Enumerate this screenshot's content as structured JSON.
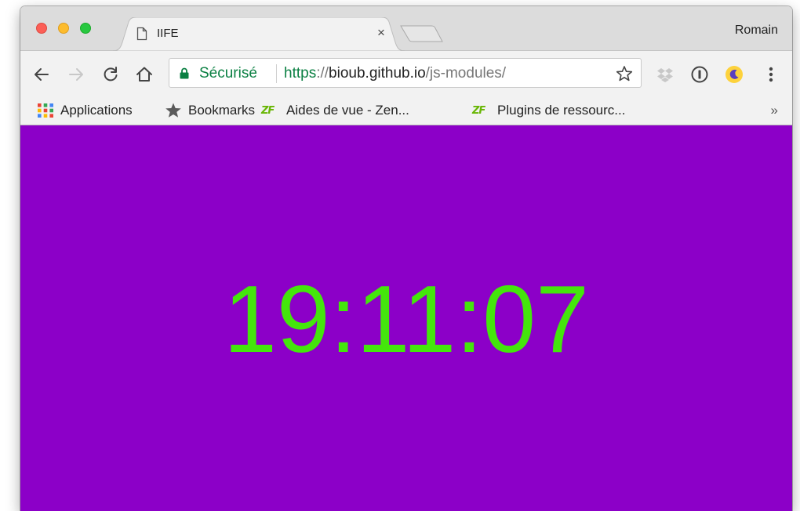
{
  "window": {
    "profile_name": "Romain"
  },
  "tabs": [
    {
      "title": "IIFE",
      "active": true,
      "close_label": "×"
    }
  ],
  "toolbar": {
    "secure_label": "Sécurisé",
    "url": {
      "scheme": "https",
      "separator": "://",
      "host": "bioub.github.io",
      "path": "/js-modules/"
    }
  },
  "bookmarks": {
    "items": [
      {
        "label": "Applications",
        "icon": "apps-grid-icon"
      },
      {
        "label": "Bookmarks",
        "icon": "star-icon"
      },
      {
        "label": "Aides de vue - Zen...",
        "icon": "zend-framework-icon",
        "icon_text": "ZF"
      },
      {
        "label": "Plugins de ressourc...",
        "icon": "zend-framework-icon",
        "icon_text": "ZF"
      }
    ],
    "overflow_label": "»"
  },
  "page": {
    "clock_text": "19:11:07"
  },
  "colors": {
    "page_background": "#8c00c8",
    "clock_text": "#44e60c",
    "secure_green": "#0b8043",
    "tab_strip": "#dcdcdc",
    "toolbar": "#f2f2f2"
  }
}
